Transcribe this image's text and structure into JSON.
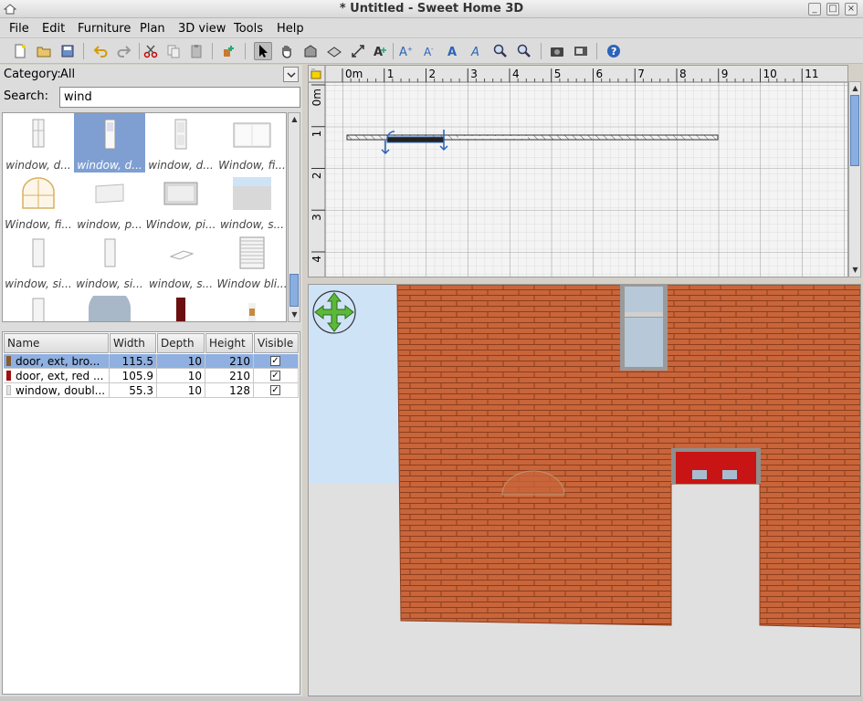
{
  "window": {
    "title": "* Untitled - Sweet Home 3D",
    "controls": [
      "minimize",
      "maximize",
      "close"
    ]
  },
  "menu": [
    "File",
    "Edit",
    "Furniture",
    "Plan",
    "3D view",
    "Tools",
    "Help"
  ],
  "toolbar": {
    "buttons": [
      "new-home-icon",
      "open-icon",
      "save-icon",
      "undo-icon",
      "redo-icon",
      "cut-icon",
      "copy-icon",
      "paste-icon",
      "add-furniture-icon",
      "select-mode-icon",
      "pan-mode-icon",
      "create-walls-icon",
      "create-rooms-icon",
      "create-dimensions-icon",
      "add-text-icon",
      "increase-text-size-icon",
      "decrease-text-size-icon",
      "bold-text-icon",
      "italic-text-icon",
      "zoom-in-icon",
      "zoom-out-icon",
      "create-photo-icon",
      "create-video-icon",
      "help-icon"
    ],
    "selected": "select-mode-icon"
  },
  "catalog": {
    "category_label": "Category:",
    "category_value": "All",
    "search_label": "Search:",
    "search_value": "wind",
    "items": [
      {
        "label": "window, d...",
        "selected": false
      },
      {
        "label": "window, d...",
        "selected": true
      },
      {
        "label": "window, d...",
        "selected": false
      },
      {
        "label": "Window, fi...",
        "selected": false
      },
      {
        "label": "Window, fi...",
        "selected": false
      },
      {
        "label": "window, p...",
        "selected": false
      },
      {
        "label": "Window, pi...",
        "selected": false
      },
      {
        "label": "window, s...",
        "selected": false
      },
      {
        "label": "window, si...",
        "selected": false
      },
      {
        "label": "window, si...",
        "selected": false
      },
      {
        "label": "window, s...",
        "selected": false
      },
      {
        "label": "Window bli...",
        "selected": false
      }
    ]
  },
  "furniture_table": {
    "columns": [
      "Name",
      "Width",
      "Depth",
      "Height",
      "Visible"
    ],
    "rows": [
      {
        "name": "door, ext, bro...",
        "width": "115.5",
        "depth": "10",
        "height": "210",
        "visible": true,
        "selected": true,
        "color": "#8a5a2b"
      },
      {
        "name": "door, ext, red ...",
        "width": "105.9",
        "depth": "10",
        "height": "210",
        "visible": true,
        "selected": false,
        "color": "#a01010"
      },
      {
        "name": "window, doubl...",
        "width": "55.3",
        "depth": "10",
        "height": "128",
        "visible": true,
        "selected": false,
        "color": "#dddddd"
      }
    ],
    "check_glyph": "✓"
  },
  "plan": {
    "ruler_x": [
      "0m",
      "1",
      "2",
      "3",
      "4",
      "5",
      "6",
      "7",
      "8",
      "9",
      "10",
      "11"
    ],
    "ruler_y": [
      "0m",
      "1",
      "2",
      "3",
      "4"
    ]
  },
  "colors": {
    "selection": "#7f9fd3",
    "brick": "#c9653a",
    "sky": "#cfe3f7",
    "ground": "#e0e0e0",
    "door_red": "#c81414"
  }
}
